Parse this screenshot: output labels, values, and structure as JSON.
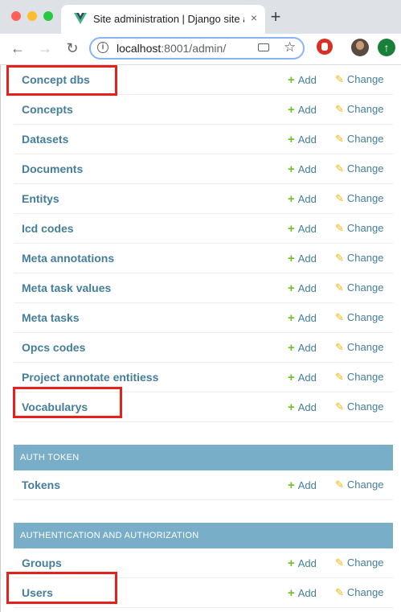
{
  "browser": {
    "tab_title": "Site administration | Django site admin",
    "tab_close": "×",
    "new_tab": "+",
    "url_host": "localhost",
    "url_rest": ":8001/admin/",
    "back": "←",
    "forward": "→",
    "reload": "↻",
    "star": "☆",
    "update_icon": "↑",
    "traffic_colors": [
      "#fe5f57",
      "#febc2e",
      "#28c840"
    ]
  },
  "actions": {
    "add": "Add",
    "change": "Change"
  },
  "models": [
    {
      "label": "Concept dbs"
    },
    {
      "label": "Concepts"
    },
    {
      "label": "Datasets"
    },
    {
      "label": "Documents"
    },
    {
      "label": "Entitys"
    },
    {
      "label": "Icd codes"
    },
    {
      "label": "Meta annotations"
    },
    {
      "label": "Meta task values"
    },
    {
      "label": "Meta tasks"
    },
    {
      "label": "Opcs codes"
    },
    {
      "label": "Project annotate entitiess"
    },
    {
      "label": "Vocabularys"
    }
  ],
  "auth_token": {
    "caption": "AUTH TOKEN",
    "rows": [
      {
        "label": "Tokens"
      }
    ]
  },
  "auth": {
    "caption": "AUTHENTICATION AND AUTHORIZATION",
    "rows": [
      {
        "label": "Groups"
      },
      {
        "label": "Users"
      }
    ]
  },
  "colors": {
    "link": "#447e9b",
    "caption_bg": "#79aec8",
    "add_plus": "#70bf2b",
    "pencil": "#efb80b",
    "highlight": "#e8201b"
  }
}
